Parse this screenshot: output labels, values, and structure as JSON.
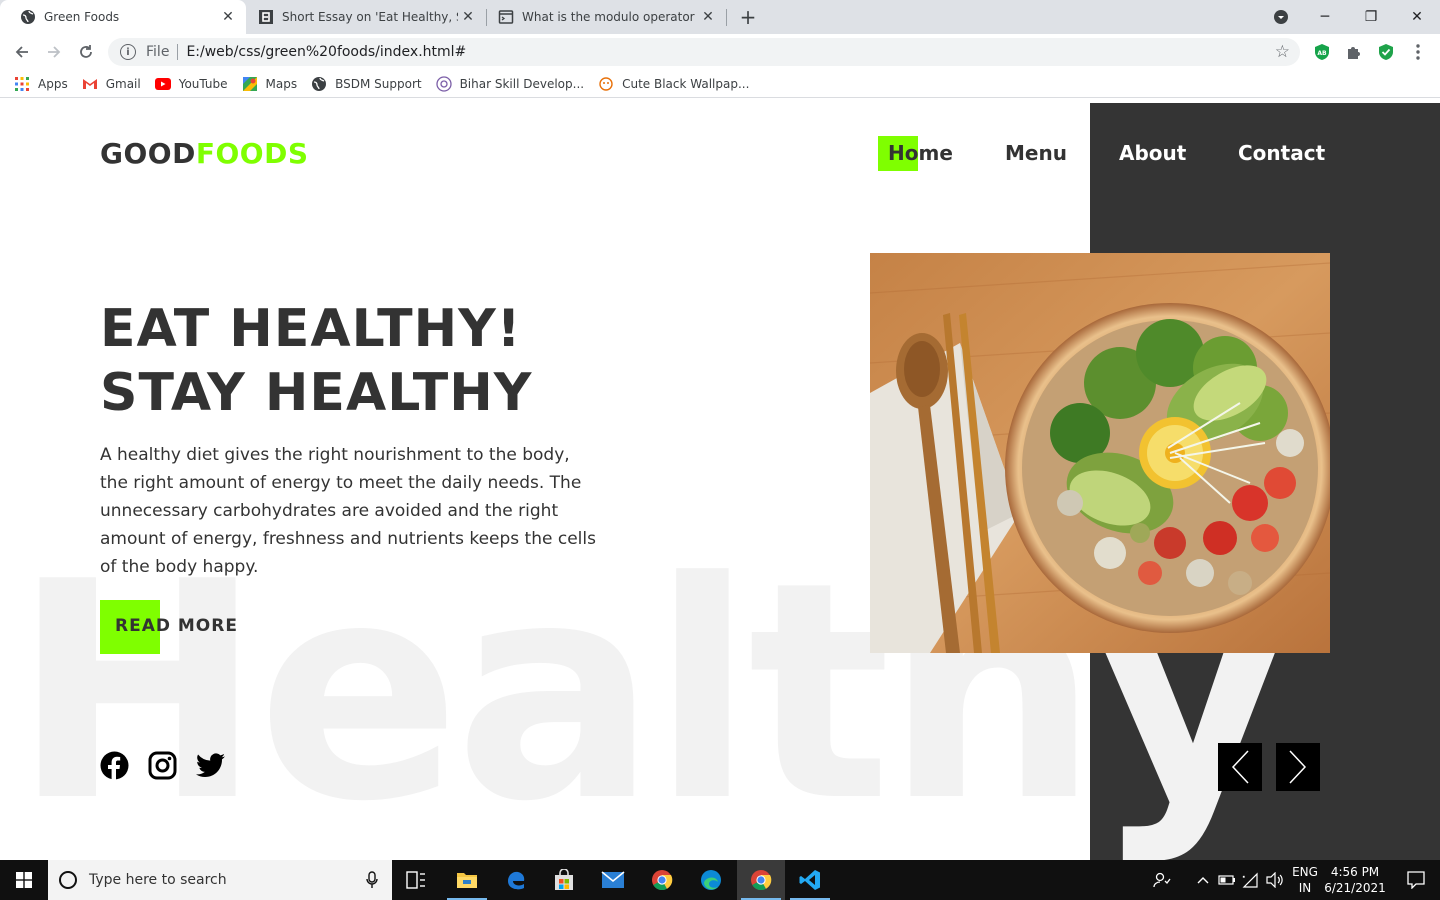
{
  "browser": {
    "tabs": [
      {
        "title": "Green Foods",
        "active": true
      },
      {
        "title": "Short Essay on 'Eat Healthy, Stay",
        "active": false
      },
      {
        "title": "What is the modulo operator in J",
        "active": false
      }
    ],
    "address": {
      "scheme": "File",
      "url": "E:/web/css/green%20foods/index.html#"
    },
    "bookmarks": [
      {
        "label": "Apps",
        "icon": "apps-grid-icon"
      },
      {
        "label": "Gmail",
        "icon": "gmail-icon"
      },
      {
        "label": "YouTube",
        "icon": "youtube-icon"
      },
      {
        "label": "Maps",
        "icon": "maps-icon"
      },
      {
        "label": "BSDM Support",
        "icon": "globe-icon"
      },
      {
        "label": "Bihar Skill Develop...",
        "icon": "site-icon"
      },
      {
        "label": "Cute Black Wallpap...",
        "icon": "site-icon"
      }
    ]
  },
  "site": {
    "logo": {
      "part1": "GOOD",
      "part2": "FOODS"
    },
    "nav": {
      "home": "Home",
      "menu": "Menu",
      "about": "About",
      "contact": "Contact"
    },
    "headline": {
      "line1": "EAT HEALTHY!",
      "line2": "STAY HEALTHY"
    },
    "description": "A healthy diet gives the right nourishment to the body, the right amount of energy to meet the daily needs. The unnecessary carbohydrates are avoided and the right amount of energy, freshness and nutrients keeps the cells of the body happy.",
    "cta": "READ MORE",
    "background_word": "Healthy",
    "social": [
      "facebook-icon",
      "instagram-icon",
      "twitter-icon"
    ],
    "colors": {
      "accent": "#7fff00",
      "dark": "#343434",
      "text": "#333333"
    }
  },
  "taskbar": {
    "search_placeholder": "Type here to search",
    "lang_line1": "ENG",
    "lang_line2": "IN",
    "time": "4:56 PM",
    "date": "6/21/2021"
  }
}
